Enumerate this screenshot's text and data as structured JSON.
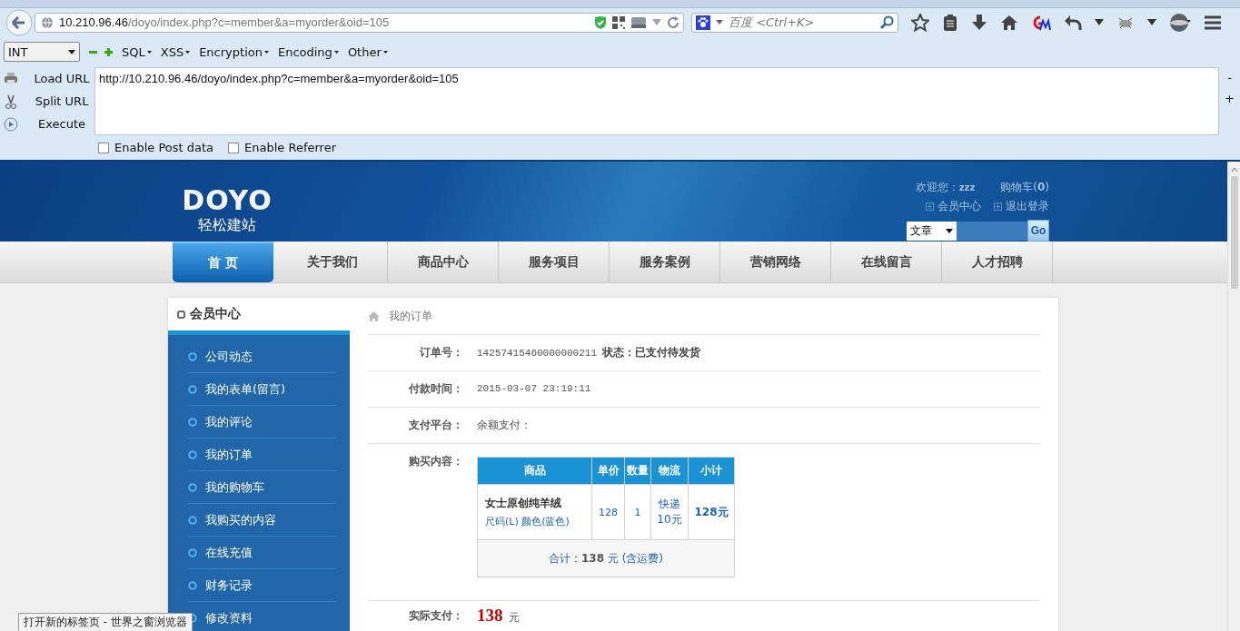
{
  "browser": {
    "url_host": "10.210.96.46",
    "url_path": "/doyo/index.php?c=member&a=myorder&oid=105",
    "search_placeholder": "百度 <Ctrl+K>"
  },
  "hackbar": {
    "select": "INT",
    "menus": [
      "SQL",
      "XSS",
      "Encryption",
      "Encoding",
      "Other"
    ],
    "actions": [
      "Load URL",
      "Split URL",
      "Execute"
    ],
    "url_value": "http://10.210.96.46/doyo/index.php?c=member&a=myorder&oid=105",
    "side_buttons": [
      "-",
      "+"
    ],
    "checkboxes": [
      {
        "label": "Enable Post data",
        "checked": false
      },
      {
        "label": "Enable Referrer",
        "checked": false
      }
    ]
  },
  "header": {
    "logo": "DOYO",
    "tagline": "轻松建站",
    "welcome": "欢迎您：",
    "user": "zzz",
    "cart": "购物车(**0**)",
    "links": [
      "会员中心",
      "退出登录"
    ],
    "search_select": "文章",
    "search_button": "Go"
  },
  "nav": [
    {
      "label": "首 页",
      "selected": true
    },
    {
      "label": "关于我们",
      "selected": false
    },
    {
      "label": "商品中心",
      "selected": false
    },
    {
      "label": "服务项目",
      "selected": false
    },
    {
      "label": "服务案例",
      "selected": false
    },
    {
      "label": "营销网络",
      "selected": false
    },
    {
      "label": "在线留言",
      "selected": false
    },
    {
      "label": "人才招聘",
      "selected": false
    }
  ],
  "sidebar": {
    "title": "会员中心",
    "items": [
      "公司动态",
      "我的表单(留言)",
      "我的评论",
      "我的订单",
      "我的购物车",
      "我购买的内容",
      "在线充值",
      "财务记录",
      "修改资料"
    ]
  },
  "order": {
    "breadcrumb": "我的订单",
    "rows": [
      {
        "kind": "number",
        "label": "订单号：",
        "value": "14257415460000000211",
        "extra": "状态：已支付待发货"
      },
      {
        "kind": "number",
        "label": "付款时间：",
        "value": "2015-03-07 23:19:11"
      },
      {
        "kind": "text",
        "label": "支付平台：",
        "value": "余额支付："
      },
      {
        "kind": "table",
        "label": "购买内容："
      }
    ],
    "table": {
      "columns": [
        "商品",
        "单价",
        "数量",
        "物流",
        "小计"
      ],
      "rows": [
        {
          "name": "女士原创纯羊绒",
          "options": "尺码(L)  颜色(蓝色)",
          "price": "128",
          "quantity": "1",
          "shipping": "快递 10元",
          "subtotal": "128元"
        }
      ],
      "total": "合计：**138** 元 (含运费)"
    },
    "paid": {
      "label": "实际支付：",
      "amount": "138",
      "unit": "元"
    }
  },
  "status_tooltip": "打开新的标签页 - 世界之窗浏览器"
}
